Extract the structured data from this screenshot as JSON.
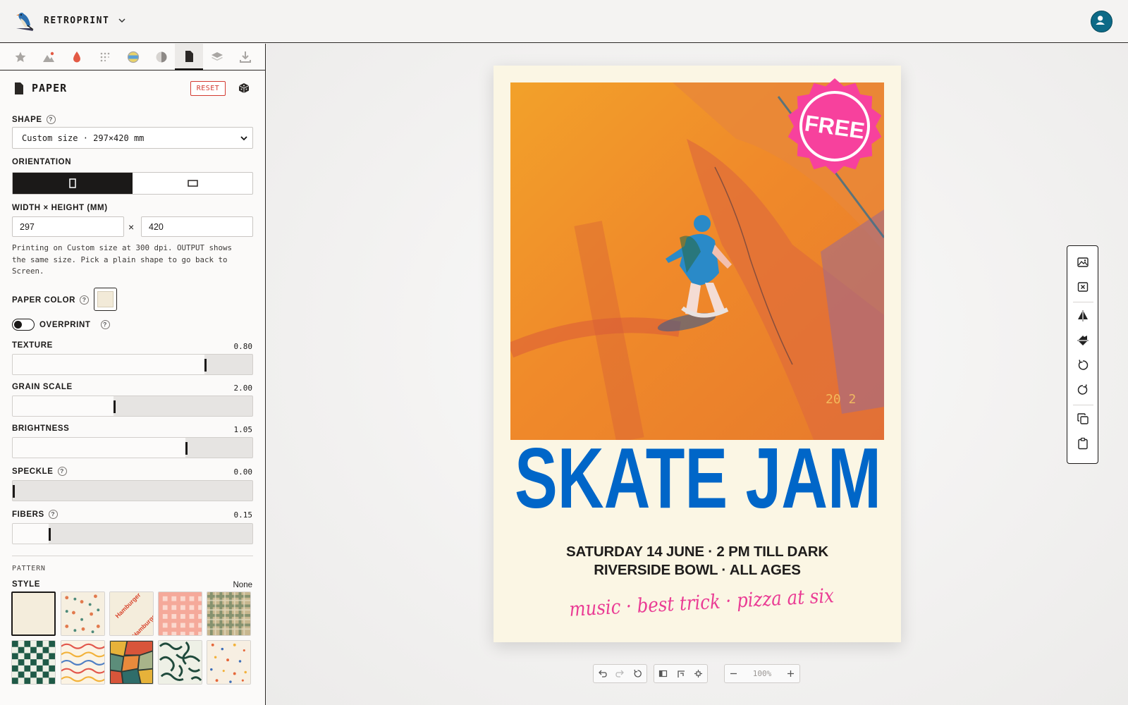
{
  "app": {
    "name": "RETROPRINT"
  },
  "panel": {
    "title": "PAPER",
    "reset_label": "RESET",
    "shape": {
      "label": "SHAPE",
      "value": "Custom size · 297×420 mm"
    },
    "orientation": {
      "label": "ORIENTATION",
      "selected": "portrait"
    },
    "dimensions": {
      "label": "WIDTH × HEIGHT (MM)",
      "width": "297",
      "height": "420",
      "separator": "×"
    },
    "help_text": "Printing on Custom size at 300 dpi. OUTPUT shows the same size. Pick a plain shape to go back to Screen.",
    "paper_color": {
      "label": "PAPER COLOR",
      "value": "#f2ead8"
    },
    "overprint": {
      "label": "OVERPRINT",
      "enabled": false
    },
    "sliders": [
      {
        "label": "TEXTURE",
        "value": "0.80",
        "position": 0.8
      },
      {
        "label": "GRAIN SCALE",
        "value": "2.00",
        "position": 0.42
      },
      {
        "label": "BRIGHTNESS",
        "value": "1.05",
        "position": 0.72
      },
      {
        "label": "SPECKLE",
        "value": "0.00",
        "position": 0.0
      },
      {
        "label": "FIBERS",
        "value": "0.15",
        "position": 0.15
      }
    ],
    "pattern": {
      "section_label": "PATTERN",
      "style_label": "STYLE",
      "style_value": "None",
      "swatch_text": "Hamburger"
    }
  },
  "tools": [
    "favorites-icon",
    "image-icon",
    "ink-icon",
    "halftone-icon",
    "colors-icon",
    "tone-icon",
    "paper-icon",
    "layers-icon",
    "export-icon"
  ],
  "poster": {
    "badge": "FREE",
    "headline": "SKATE JAM",
    "line1": "SATURDAY 14 JUNE · 2 PM TILL DARK",
    "line2": "RIVERSIDE BOWL · ALL AGES",
    "script": "music · best trick · pizza at six",
    "photo_stamp": "20 2",
    "colors": {
      "headline": "#0066c8",
      "badge": "#f7419d",
      "script": "#ea3b94",
      "paper": "#fbf6e4"
    }
  },
  "zoom": {
    "value": "100%"
  }
}
